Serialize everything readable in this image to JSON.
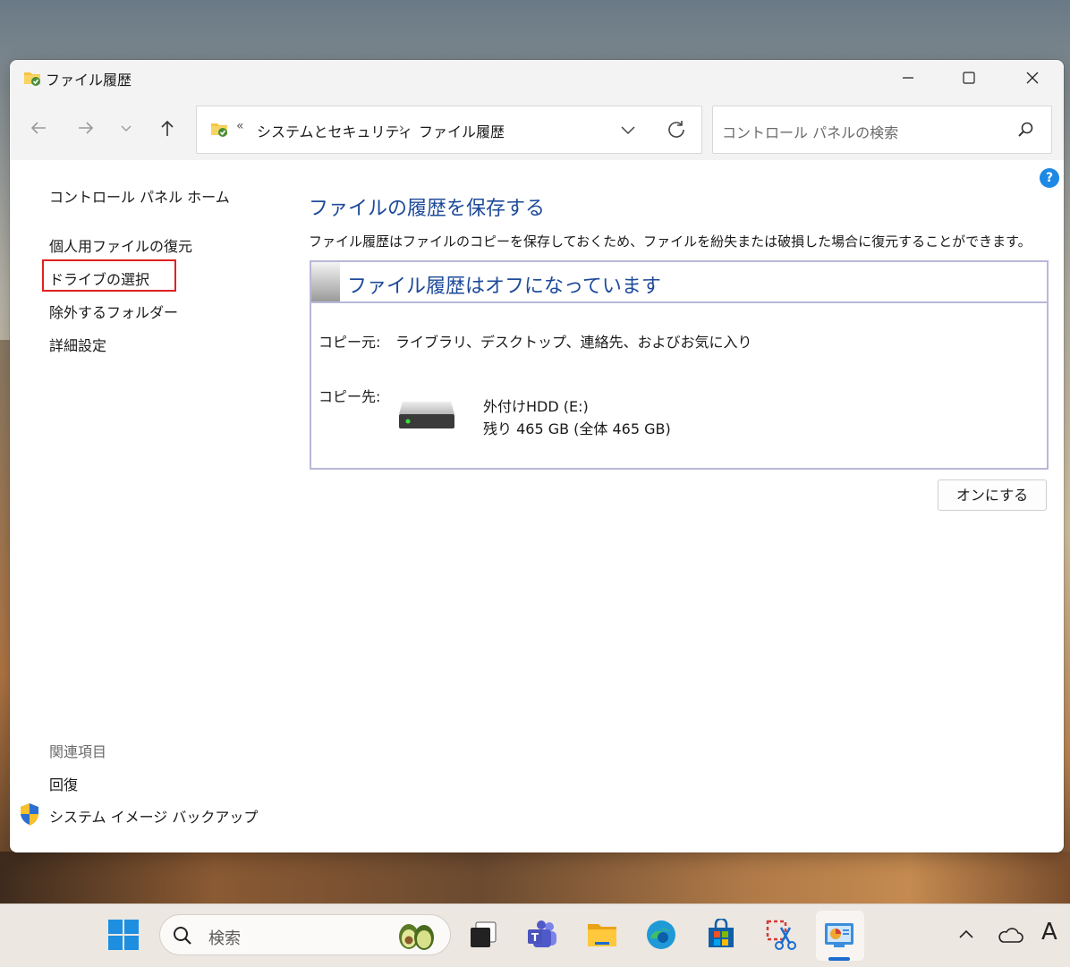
{
  "window": {
    "title": "ファイル履歴",
    "controls": [
      "minimize-icon",
      "maximize-icon",
      "close-icon"
    ]
  },
  "nav": {
    "address_overflow": "«",
    "breadcrumb": [
      "システムとセキュリティ",
      "ファイル履歴"
    ],
    "breadcrumb_separator": "›",
    "search_placeholder": "コントロール パネルの検索",
    "help": "?"
  },
  "sidebar": {
    "items": [
      {
        "label": "コントロール パネル ホーム"
      },
      {
        "label": "個人用ファイルの復元"
      },
      {
        "label": "ドライブの選択"
      },
      {
        "label": "除外するフォルダー"
      },
      {
        "label": "詳細設定"
      }
    ],
    "related_heading": "関連項目",
    "related": [
      {
        "label": "回復"
      },
      {
        "label": "システム イメージ バックアップ"
      }
    ]
  },
  "main": {
    "heading": "ファイルの履歴を保存する",
    "description": "ファイル履歴はファイルのコピーを保存しておくため、ファイルを紛失または破損した場合に復元することができます。",
    "status_title": "ファイル履歴はオフになっています",
    "source_label": "コピー元:",
    "source_value": "ライブラリ、デスクトップ、連絡先、およびお気に入り",
    "dest_label": "コピー先:",
    "drive_name": "外付けHDD (E:)",
    "drive_space": "残り 465 GB (全体 465 GB)",
    "turn_on_button": "オンにする"
  },
  "taskbar": {
    "search_text": "検索",
    "ime": "A"
  },
  "colors": {
    "heading_blue": "#1e4a9a",
    "highlight_red": "#e02020",
    "accent": "#1a6ccf"
  }
}
